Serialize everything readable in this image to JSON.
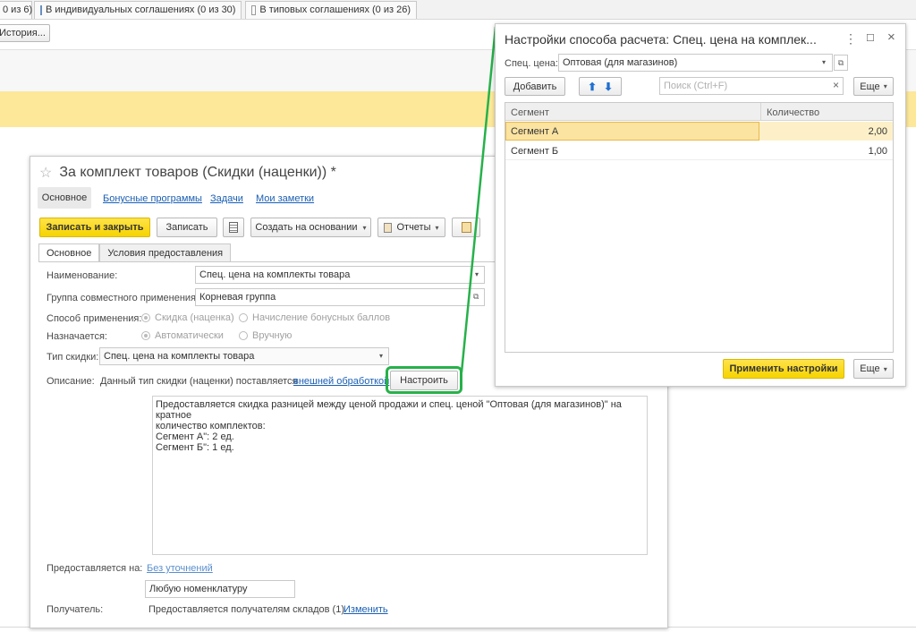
{
  "bg": {
    "tabs": [
      {
        "label": "0 из 6)"
      },
      {
        "label": "В индивидуальных соглашениях (0 из 30)"
      },
      {
        "label": "В типовых соглашениях (0 из 26)"
      }
    ],
    "history_button": "История..."
  },
  "form": {
    "title": "За комплект товаров (Скидки (наценки)) *",
    "nav": [
      "Основное",
      "Бонусные программы",
      "Задачи",
      "Мои заметки"
    ],
    "toolbar": {
      "save_close": "Записать и закрыть",
      "save": "Записать",
      "create_based": "Создать на основании",
      "reports": "Отчеты"
    },
    "tabs": [
      "Основное",
      "Условия предоставления"
    ],
    "name_label": "Наименование:",
    "name_value": "Спец. цена на комплекты товара",
    "group_label": "Группа совместного применения:",
    "group_value": "Корневая группа",
    "method_label": "Способ применения:",
    "method_opt1": "Скидка (наценка)",
    "method_opt2": "Начисление бонусных баллов",
    "assign_label": "Назначается:",
    "assign_opt1": "Автоматически",
    "assign_opt2": "Вручную",
    "type_label": "Тип скидки:",
    "type_value": "Спец. цена на комплекты товара",
    "desc_label": "Описание:",
    "desc_text": "Данный тип скидки (наценки) поставляется",
    "desc_link": "внешней обработкой",
    "configure_button": "Настроить",
    "description_lines": [
      "Предоставляется скидка разницей между ценой продажи и спец. ценой \"Оптовая (для магазинов)\" на кратное",
      "количество комплектов:",
      "Сегмент А\": 2 ед.",
      "Сегмент Б\": 1 ед."
    ],
    "provided_label": "Предоставляется на:",
    "provided_link": "Без уточнений",
    "nomenclature_value": "Любую номенклатуру",
    "recipient_label": "Получатель:",
    "recipient_text": "Предоставляется получателям складов (1)",
    "recipient_link": "Изменить"
  },
  "dialog": {
    "title": "Настройки способа расчета: Спец. цена на комплек...",
    "price_label": "Спец. цена:",
    "price_value": "Оптовая (для магазинов)",
    "add_button": "Добавить",
    "search_placeholder": "Поиск (Ctrl+F)",
    "more_button": "Еще",
    "columns": [
      "Сегмент",
      "Количество"
    ],
    "rows": [
      {
        "segment": "Сегмент А",
        "qty": "2,00"
      },
      {
        "segment": "Сегмент Б",
        "qty": "1,00"
      }
    ],
    "apply_button": "Применить настройки",
    "more_button2": "Еще"
  },
  "colors": {
    "accent_yellow": "#fde89a",
    "highlight_green": "#26b14a",
    "primary_button": "#f5d400"
  }
}
